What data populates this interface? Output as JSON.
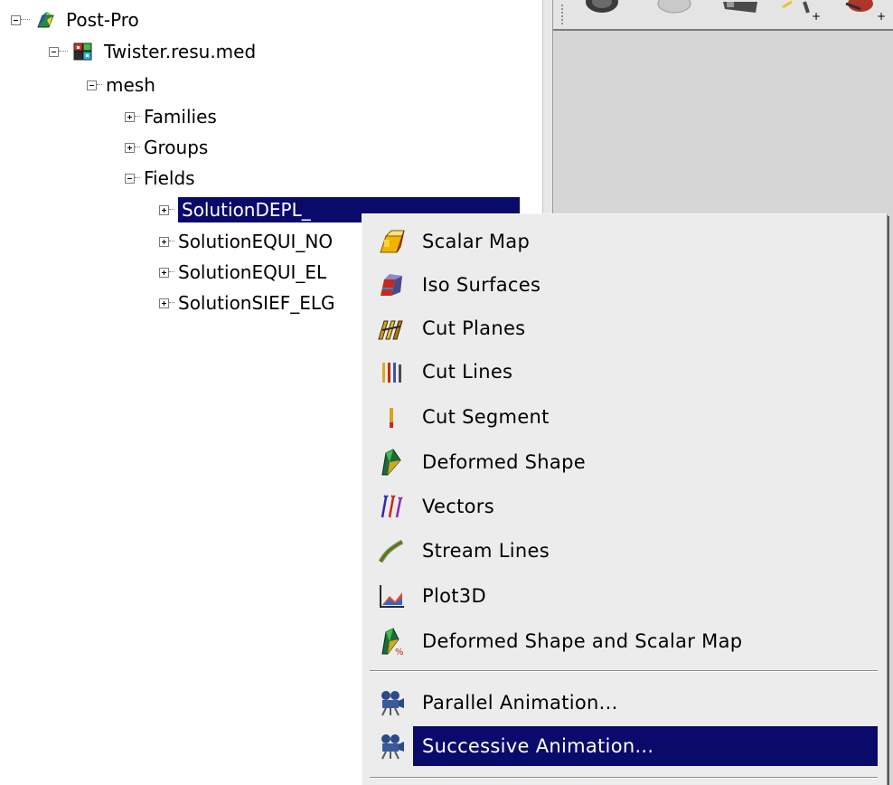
{
  "tree": {
    "items": [
      {
        "label": "Post-Pro",
        "icon": "post-pro-icon"
      },
      {
        "label": "Twister.resu.med",
        "icon": "med-file-icon"
      },
      {
        "label": "mesh"
      },
      {
        "label": "Families"
      },
      {
        "label": "Groups"
      },
      {
        "label": "Fields"
      },
      {
        "label": "SolutionDEPL_"
      },
      {
        "label": "SolutionEQUI_NO"
      },
      {
        "label": "SolutionEQUI_EL"
      },
      {
        "label": "SolutionSIEF_ELG"
      }
    ],
    "selected_color": "#0a0a6a"
  },
  "context_menu": {
    "items": [
      {
        "label": "Scalar Map",
        "icon": "scalar-map-icon"
      },
      {
        "label": "Iso Surfaces",
        "icon": "iso-surfaces-icon"
      },
      {
        "label": "Cut Planes",
        "icon": "cut-planes-icon"
      },
      {
        "label": "Cut Lines",
        "icon": "cut-lines-icon"
      },
      {
        "label": "Cut Segment",
        "icon": "cut-segment-icon"
      },
      {
        "label": "Deformed Shape",
        "icon": "deformed-shape-icon"
      },
      {
        "label": "Vectors",
        "icon": "vectors-icon"
      },
      {
        "label": "Stream Lines",
        "icon": "stream-lines-icon"
      },
      {
        "label": "Plot3D",
        "icon": "plot3d-icon"
      },
      {
        "label": "Deformed Shape and Scalar Map",
        "icon": "deformed-shape-scalar-map-icon"
      },
      {
        "label": "Parallel Animation...",
        "icon": "movie-camera-icon"
      },
      {
        "label": "Successive Animation...",
        "icon": "movie-camera-icon"
      }
    ],
    "highlight_color": "#0a0a6a"
  }
}
